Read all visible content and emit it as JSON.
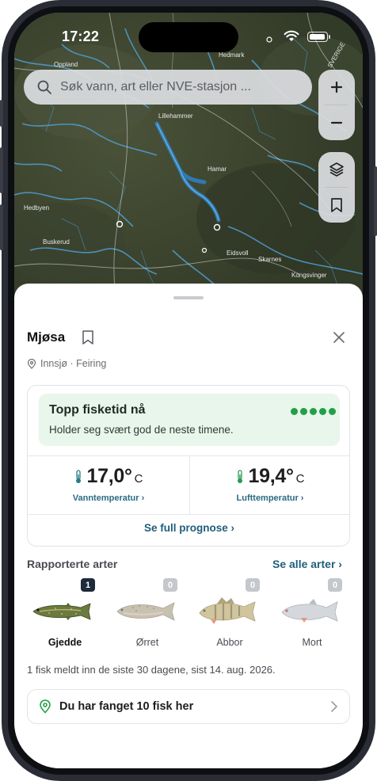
{
  "status": {
    "time": "17:22"
  },
  "search": {
    "placeholder": "Søk vann, art eller NVE-stasjon ..."
  },
  "map_controls": {
    "zoom_in": "+",
    "zoom_out": "−",
    "icons": [
      "layers-icon",
      "bookmark-icon"
    ]
  },
  "map_labels": {
    "place1": "Oppland",
    "place2": "Lillehammer",
    "place3": "Hamar",
    "place4": "Hedmark",
    "place5": "Hedbyen",
    "place6": "Eidsvoll",
    "place7": "Skarnes",
    "place8": "Kongsvinger",
    "place9": "Buskerud",
    "place10": "SVERIGE"
  },
  "lake": {
    "name": "Mjøsa",
    "subtitle": "Innsjø · Feiring"
  },
  "best_time": {
    "title": "Topp fisketid nå",
    "subtitle": "Holder seg svært god de neste timene.",
    "rating_level": 5,
    "rating_max": 5,
    "color": "#22a047"
  },
  "water_temp": {
    "value": "17,0°",
    "unit": "C",
    "label": "Vanntemperatur ›"
  },
  "air_temp": {
    "value": "19,4°",
    "unit": "C",
    "label": "Lufttemperatur ›"
  },
  "forecast_link": "Se full prognose ›",
  "species_section": {
    "title": "Rapporterte arter",
    "see_all": "Se alle arter ›",
    "items": [
      {
        "name": "Gjedde",
        "count": "1",
        "active": true
      },
      {
        "name": "Ørret",
        "count": "0",
        "active": false
      },
      {
        "name": "Abbor",
        "count": "0",
        "active": false
      },
      {
        "name": "Mort",
        "count": "0",
        "active": false
      }
    ]
  },
  "report_text": "1 fisk meldt inn de siste 30 dagene, sist 14. aug. 2026.",
  "caught": {
    "label": "Du har fanget 10 fisk her"
  },
  "colors": {
    "accent": "#1f5f7a",
    "green": "#22a047",
    "badge_active": "#1d2b3a",
    "badge_inactive": "#c4c7cc"
  }
}
